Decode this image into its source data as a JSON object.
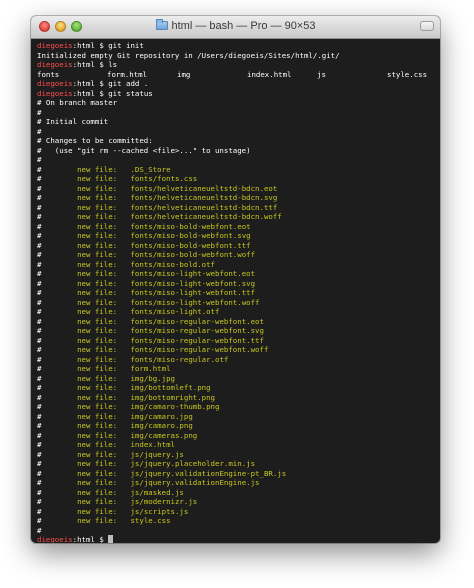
{
  "window": {
    "title": "html — bash — Pro — 90×53"
  },
  "prompt": {
    "user": "diegoeis",
    "host": "html",
    "suffix": " $ "
  },
  "session": [
    {
      "type": "prompt",
      "cmd": "git init"
    },
    {
      "type": "text",
      "text": "Initialized empty Git repository in /Users/diegoeis/Sites/html/.git/"
    },
    {
      "type": "prompt",
      "cmd": "ls"
    },
    {
      "type": "ls",
      "items": [
        "fonts",
        "form.html",
        "img",
        "index.html",
        "js",
        "style.css"
      ]
    },
    {
      "type": "prompt",
      "cmd": "git add ."
    },
    {
      "type": "prompt",
      "cmd": "git status"
    },
    {
      "type": "text",
      "text": "# On branch master"
    },
    {
      "type": "text",
      "text": "#"
    },
    {
      "type": "text",
      "text": "# Initial commit"
    },
    {
      "type": "text",
      "text": "#"
    },
    {
      "type": "text",
      "text": "# Changes to be committed:"
    },
    {
      "type": "text",
      "text": "#   (use \"git rm --cached <file>...\" to unstage)"
    },
    {
      "type": "text",
      "text": "#"
    }
  ],
  "status": {
    "hash": "#",
    "label": "new file:",
    "files": [
      ".DS_Store",
      "fonts/fonts.css",
      "fonts/helveticaneueltstd-bdcn.eot",
      "fonts/helveticaneueltstd-bdcn.svg",
      "fonts/helveticaneueltstd-bdcn.ttf",
      "fonts/helveticaneueltstd-bdcn.woff",
      "fonts/miso-bold-webfont.eot",
      "fonts/miso-bold-webfont.svg",
      "fonts/miso-bold-webfont.ttf",
      "fonts/miso-bold-webfont.woff",
      "fonts/miso-bold.otf",
      "fonts/miso-light-webfont.eot",
      "fonts/miso-light-webfont.svg",
      "fonts/miso-light-webfont.ttf",
      "fonts/miso-light-webfont.woff",
      "fonts/miso-light.otf",
      "fonts/miso-regular-webfont.eot",
      "fonts/miso-regular-webfont.svg",
      "fonts/miso-regular-webfont.ttf",
      "fonts/miso-regular-webfont.woff",
      "fonts/miso-regular.otf",
      "form.html",
      "img/bg.jpg",
      "img/bottomleft.png",
      "img/bottomright.png",
      "img/camaro-thumb.png",
      "img/camaro.jpg",
      "img/camaro.png",
      "img/cameras.png",
      "index.html",
      "js/jquery.js",
      "js/jquery.placeholder.min.js",
      "js/jquery.validationEngine-pt_BR.js",
      "js/jquery.validationEngine.js",
      "js/masked.js",
      "js/modernizr.js",
      "js/scripts.js",
      "style.css"
    ],
    "trailer": "#"
  },
  "colors": {
    "background": "#1d1d1d",
    "user": "#ff4d4d",
    "text": "#ffffff",
    "new_file": "#c8c81e"
  }
}
